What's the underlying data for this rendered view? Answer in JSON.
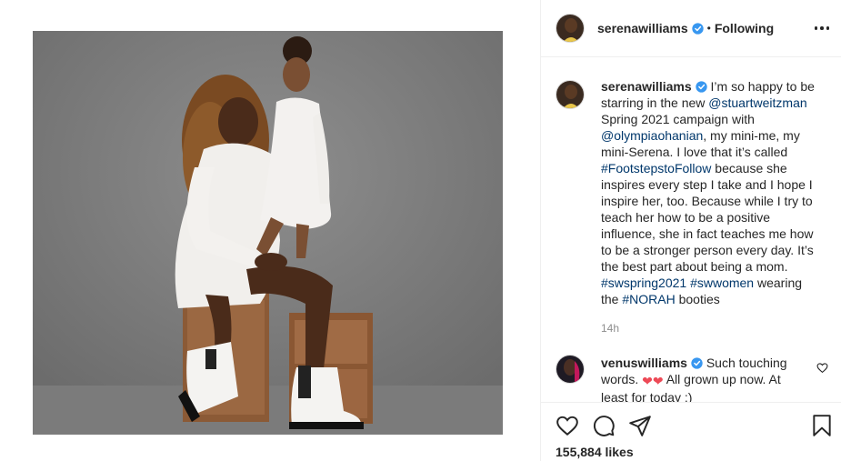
{
  "post": {
    "username": "serenawilliams",
    "separator": "•",
    "follow_status": "Following",
    "caption": {
      "username": "serenawilliams",
      "text_1": " I’m so happy to be starring in the new ",
      "mention_1": "@stuartweitzman",
      "text_2": " Spring 2021 campaign with ",
      "mention_2": "@olympiaohanian",
      "text_3": ", my mini-me, my mini-Serena. I love that it’s called ",
      "hashtag_1": "#FootstepstoFollow",
      "text_4": " because she inspires every step I take and I hope I inspire her, too. Because while I try to teach her how to be a positive influence, she in fact teaches me how to be a stronger person every day. It’s the best part about being a mom. ",
      "hashtag_2": "#swspring2021",
      "text_5": " ",
      "hashtag_3": "#swwomen",
      "text_6": " wearing the ",
      "hashtag_4": "#NORAH",
      "text_7": " booties",
      "time": "14h"
    },
    "comment": {
      "username": "venuswilliams",
      "text_1": " Such touching words. ",
      "emoji": "❤❤",
      "text_2": " All grown up now. At least for today :)"
    },
    "likes": "155,884 likes"
  },
  "icons": [
    "verified-badge-icon",
    "more-options-icon",
    "heart-icon",
    "comment-icon",
    "share-icon",
    "bookmark-icon"
  ],
  "colors": {
    "link": "#00376b",
    "verified": "#3897f0",
    "border": "#efefef",
    "muted": "#8e8e8e",
    "heart": "#ed4956"
  }
}
